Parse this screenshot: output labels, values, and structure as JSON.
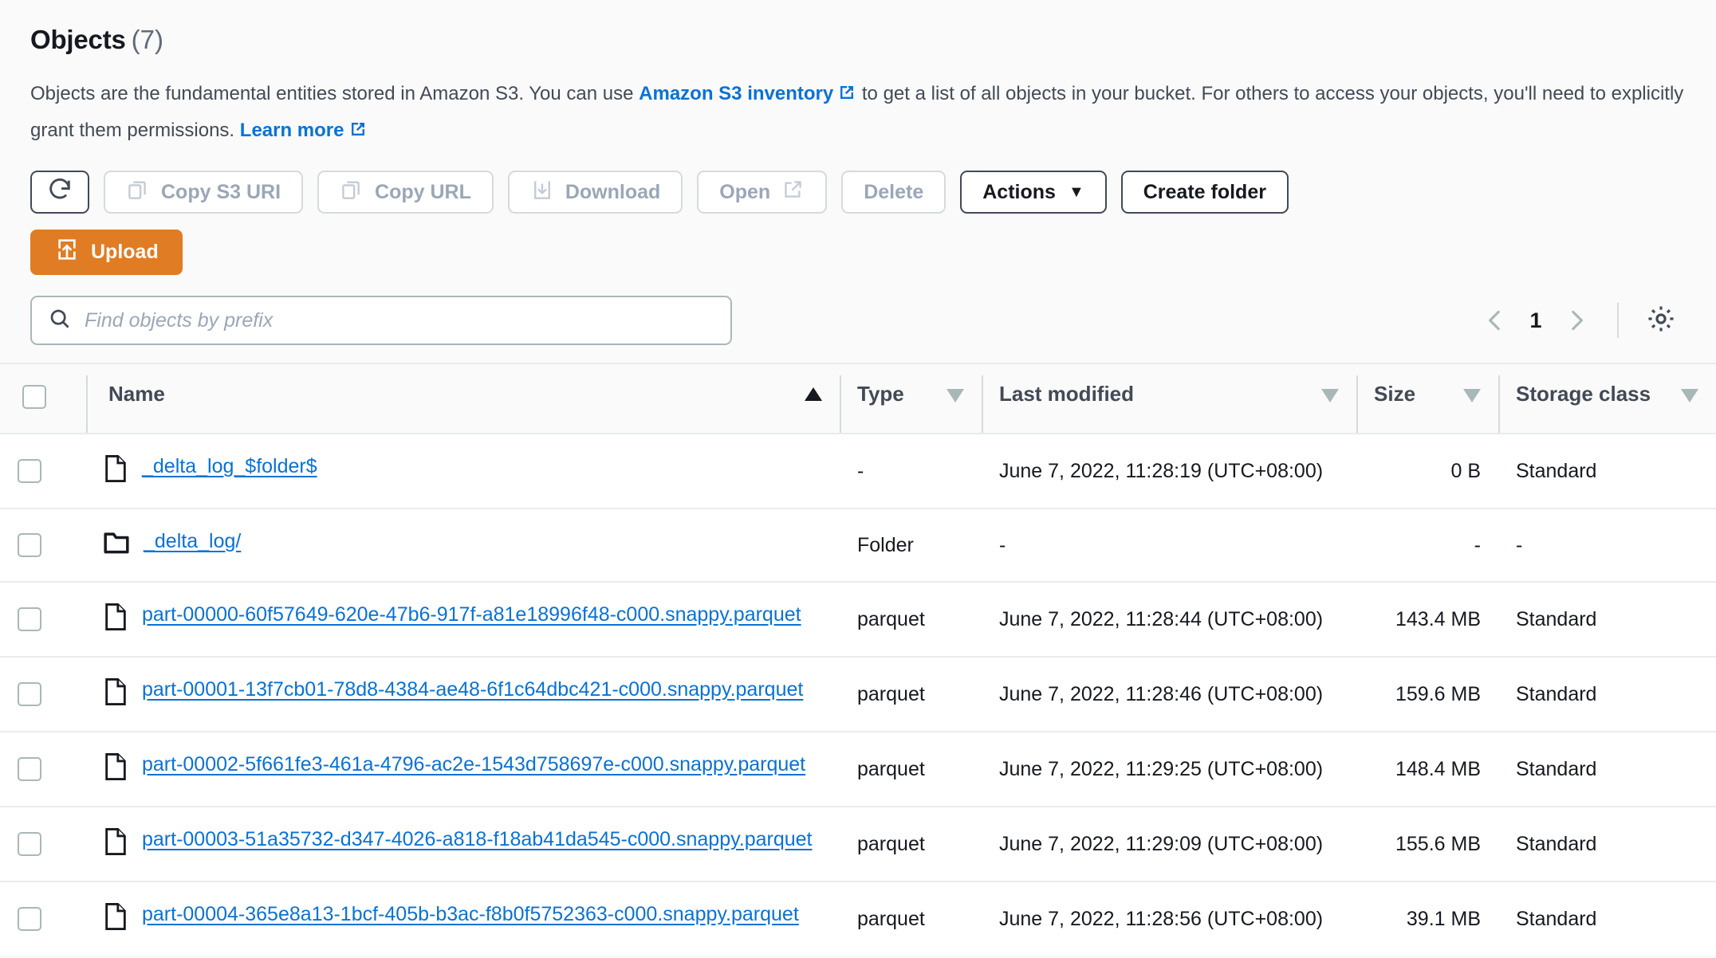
{
  "header": {
    "title": "Objects",
    "count": "(7)",
    "description_part1": "Objects are the fundamental entities stored in Amazon S3. You can use ",
    "inventory_link": "Amazon S3 inventory",
    "description_part2": " to get a list of all objects in your bucket. For others to access your objects, you'll need to explicitly grant them permissions. ",
    "learn_more_link": "Learn more"
  },
  "toolbar": {
    "refresh_label": "",
    "copy_s3_uri_label": "Copy S3 URI",
    "copy_url_label": "Copy URL",
    "download_label": "Download",
    "open_label": "Open",
    "delete_label": "Delete",
    "actions_label": "Actions",
    "actions_caret": "▼",
    "create_folder_label": "Create folder",
    "upload_label": "Upload"
  },
  "search": {
    "placeholder": "Find objects by prefix",
    "value": ""
  },
  "pagination": {
    "prev_label": "‹",
    "page_number": "1",
    "next_label": "›"
  },
  "table": {
    "columns": [
      {
        "label": "Name",
        "sort": "asc"
      },
      {
        "label": "Type",
        "sort": "none"
      },
      {
        "label": "Last modified",
        "sort": "none"
      },
      {
        "label": "Size",
        "sort": "none"
      },
      {
        "label": "Storage class",
        "sort": "none"
      }
    ],
    "rows": [
      {
        "icon": "file-icon",
        "name": "_delta_log_$folder$",
        "type": "-",
        "last_modified": "June 7, 2022, 11:28:19 (UTC+08:00)",
        "size": "0 B",
        "storage_class": "Standard"
      },
      {
        "icon": "folder-icon",
        "name": "_delta_log/",
        "type": "Folder",
        "last_modified": "-",
        "size": "-",
        "storage_class": "-"
      },
      {
        "icon": "file-icon",
        "name": "part-00000-60f57649-620e-47b6-917f-a81e18996f48-c000.snappy.parquet",
        "type": "parquet",
        "last_modified": "June 7, 2022, 11:28:44 (UTC+08:00)",
        "size": "143.4 MB",
        "storage_class": "Standard"
      },
      {
        "icon": "file-icon",
        "name": "part-00001-13f7cb01-78d8-4384-ae48-6f1c64dbc421-c000.snappy.parquet",
        "type": "parquet",
        "last_modified": "June 7, 2022, 11:28:46 (UTC+08:00)",
        "size": "159.6 MB",
        "storage_class": "Standard"
      },
      {
        "icon": "file-icon",
        "name": "part-00002-5f661fe3-461a-4796-ac2e-1543d758697e-c000.snappy.parquet",
        "type": "parquet",
        "last_modified": "June 7, 2022, 11:29:25 (UTC+08:00)",
        "size": "148.4 MB",
        "storage_class": "Standard"
      },
      {
        "icon": "file-icon",
        "name": "part-00003-51a35732-d347-4026-a818-f18ab41da545-c000.snappy.parquet",
        "type": "parquet",
        "last_modified": "June 7, 2022, 11:29:09 (UTC+08:00)",
        "size": "155.6 MB",
        "storage_class": "Standard"
      },
      {
        "icon": "file-icon",
        "name": "part-00004-365e8a13-1bcf-405b-b3ac-f8b0f5752363-c000.snappy.parquet",
        "type": "parquet",
        "last_modified": "June 7, 2022, 11:28:56 (UTC+08:00)",
        "size": "39.1 MB",
        "storage_class": "Standard"
      }
    ]
  },
  "colors": {
    "link": "#0972d3",
    "upload_orange": "#e07c24",
    "text_dark": "#16191f",
    "text_muted": "#414a56",
    "border": "#d5dbdb",
    "page_bg": "#fafafa"
  }
}
